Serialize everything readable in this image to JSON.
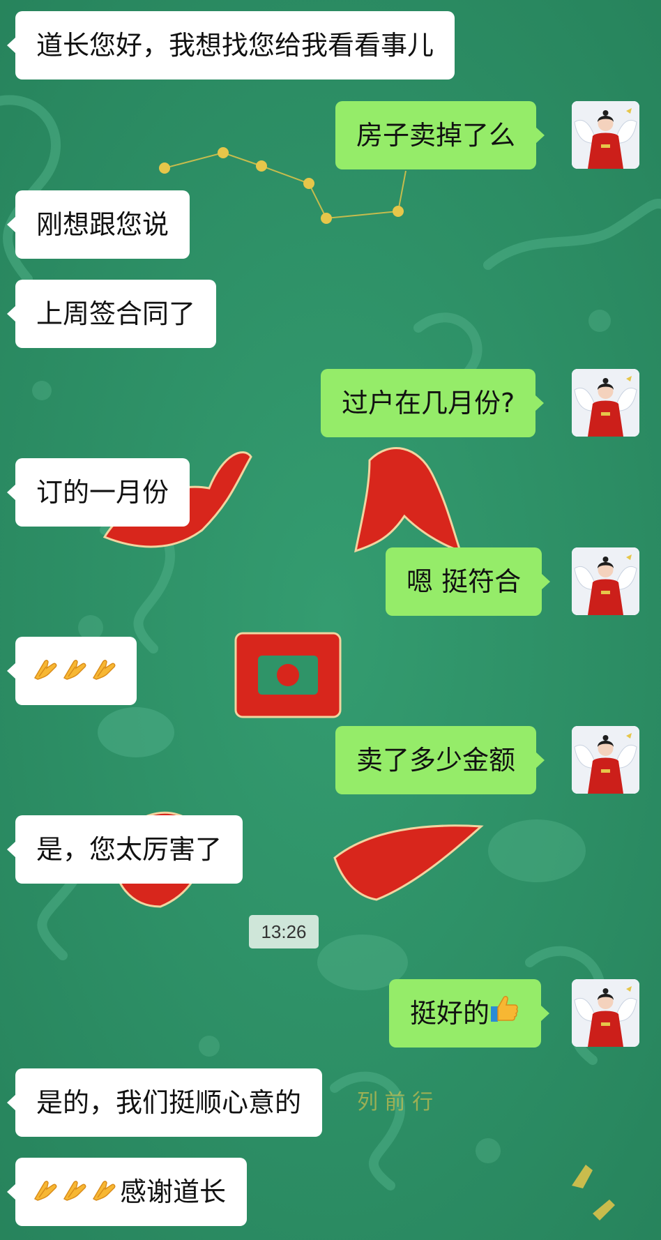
{
  "chat": {
    "timestamp": "13:26",
    "wallpaper_text": "列 前 行",
    "messages": [
      {
        "side": "in",
        "text": "道长您好，我想找您给我看看事儿"
      },
      {
        "side": "out",
        "text": "房子卖掉了么"
      },
      {
        "side": "in",
        "text": "刚想跟您说"
      },
      {
        "side": "in",
        "text": "上周签合同了"
      },
      {
        "side": "out",
        "text": "过户在几月份?"
      },
      {
        "side": "in",
        "text": "订的一月份"
      },
      {
        "side": "out",
        "text": "嗯 挺符合"
      },
      {
        "side": "in",
        "text": "",
        "emoji": [
          "folded-hands-emoji",
          "folded-hands-emoji",
          "folded-hands-emoji"
        ]
      },
      {
        "side": "out",
        "text": "卖了多少金额"
      },
      {
        "side": "in",
        "text": "是，您太厉害了"
      },
      {
        "side": "out",
        "text": "挺好的",
        "emoji_after": "thumbs-up-emoji"
      },
      {
        "side": "in",
        "text": "是的，我们挺顺心意的"
      },
      {
        "side": "in",
        "text": "感谢道长",
        "emoji_before": [
          "folded-hands-emoji",
          "folded-hands-emoji",
          "folded-hands-emoji"
        ]
      }
    ]
  },
  "colors": {
    "background": "#2f9468",
    "incoming_bubble": "#ffffff",
    "outgoing_bubble": "#95ec69",
    "wallpaper_red": "#d8261c",
    "wallpaper_gold": "#e6c64a"
  }
}
